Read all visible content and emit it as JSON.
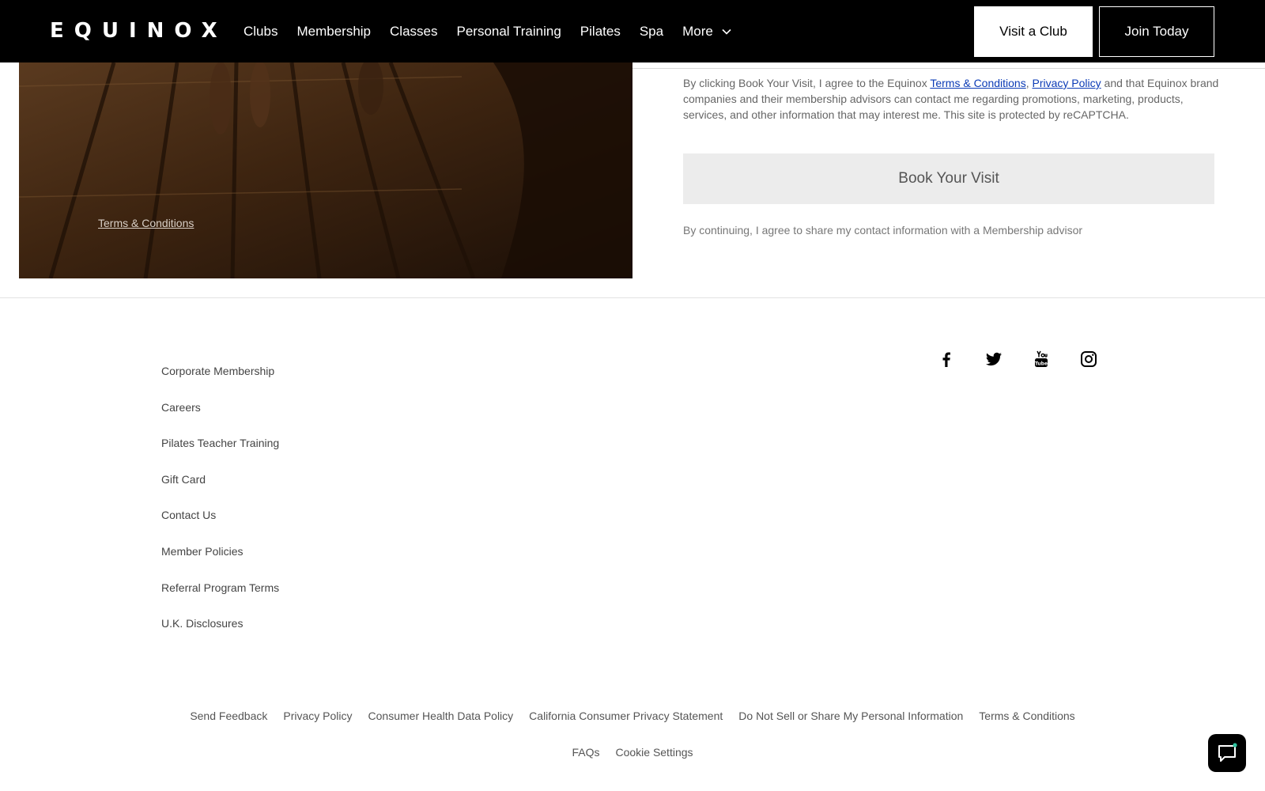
{
  "header": {
    "logo": "EQUINOX",
    "nav": [
      "Clubs",
      "Membership",
      "Classes",
      "Personal Training",
      "Pilates",
      "Spa",
      "More"
    ],
    "visit_button": "Visit a Club",
    "join_button": "Join Today"
  },
  "hero": {
    "terms_link": "Terms & Conditions"
  },
  "booking": {
    "consent_prefix": "By clicking Book Your Visit, I agree to the Equinox ",
    "terms_link": "Terms & Conditions",
    "comma": ", ",
    "privacy_link": "Privacy Policy",
    "consent_suffix": " and that Equinox brand companies and their membership advisors can contact me regarding promotions, marketing, products, services, and other information that may interest me. This site is protected by reCAPTCHA.",
    "book_button": "Book Your Visit",
    "continue_note": "By continuing, I agree to share my contact information with a Membership advisor"
  },
  "footer": {
    "links": [
      "Corporate Membership",
      "Careers",
      "Pilates Teacher Training",
      "Gift Card",
      "Contact Us",
      "Member Policies",
      "Referral Program Terms",
      "U.K. Disclosures"
    ],
    "social": [
      "facebook-icon",
      "twitter-icon",
      "youtube-icon",
      "instagram-icon"
    ],
    "bottom_row1": [
      "Send Feedback",
      "Privacy Policy",
      "Consumer Health Data Policy",
      "California Consumer Privacy Statement",
      "Do Not Sell or Share My Personal Information",
      "Terms & Conditions"
    ],
    "bottom_row2": [
      "FAQs",
      "Cookie Settings"
    ]
  },
  "colors": {
    "header_bg": "#000000",
    "link_blue": "#0b3bb6",
    "book_button_bg": "#ececec"
  }
}
